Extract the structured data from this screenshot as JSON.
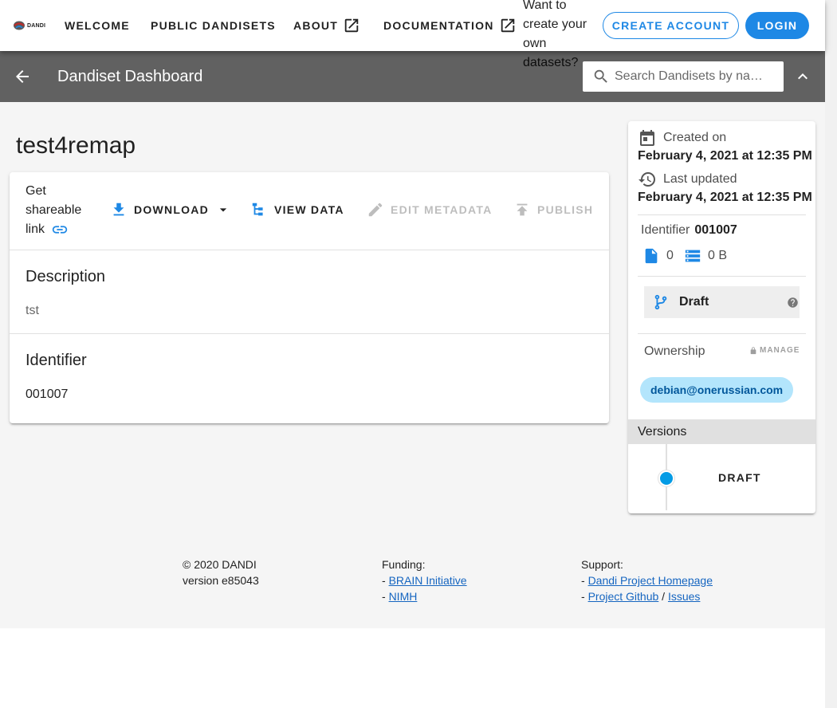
{
  "app": {
    "logo_text": "DANDI",
    "nav": {
      "welcome": "WELCOME",
      "public_dandisets": "PUBLIC DANDISETS",
      "about": "ABOUT",
      "documentation": "DOCUMENTATION"
    },
    "prompt_text": "Want to create your own datasets?",
    "create_account_label": "CREATE ACCOUNT",
    "login_label": "LOGIN"
  },
  "toolbar": {
    "title": "Dandiset Dashboard",
    "search_placeholder": "Search Dandisets by na…"
  },
  "dandiset": {
    "title": "test4remap",
    "actions": {
      "share": "Get shareable link",
      "download": "DOWNLOAD",
      "view_data": "VIEW DATA",
      "edit_metadata": "EDIT METADATA",
      "publish": "PUBLISH"
    },
    "description_heading": "Description",
    "description": "tst",
    "identifier_heading": "Identifier",
    "identifier": "001007"
  },
  "side": {
    "created_label": "Created on",
    "created_date": "February 4, 2021 at 12:35 PM",
    "updated_label": "Last updated",
    "updated_date": "February 4, 2021 at 12:35 PM",
    "identifier_label": "Identifier",
    "identifier_value": "001007",
    "file_count": "0",
    "size": "0 B",
    "status": "Draft",
    "ownership_label": "Ownership",
    "manage_label": "MANAGE",
    "owner": "debian@onerussian.com",
    "versions_label": "Versions",
    "version_name": "DRAFT"
  },
  "footer": {
    "copyright": "© 2020 DANDI",
    "version": "version e85043",
    "funding_label": "Funding:",
    "funding_links": [
      "BRAIN Initiative",
      "NIMH"
    ],
    "support_label": "Support:",
    "support_link_1": "Dandi Project Homepage",
    "support_link_2": "Project Github",
    "support_link_3": "Issues"
  },
  "colors": {
    "primary": "#1e88e5",
    "toolbar": "#616161",
    "accent": "#039be5",
    "chip": "#b3e5fc"
  }
}
